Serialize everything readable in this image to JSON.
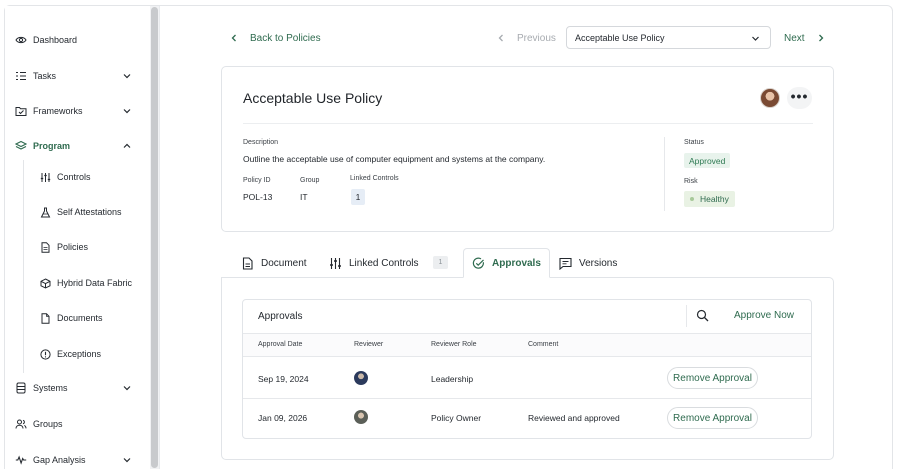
{
  "sidebar": {
    "items": [
      {
        "label": "Dashboard",
        "icon": "eye-icon"
      },
      {
        "label": "Tasks",
        "icon": "list-icon"
      },
      {
        "label": "Frameworks",
        "icon": "folder-check-icon"
      },
      {
        "label": "Program",
        "icon": "layers-icon"
      },
      {
        "label": "Systems",
        "icon": "database-icon"
      },
      {
        "label": "Groups",
        "icon": "users-icon"
      },
      {
        "label": "Gap Analysis",
        "icon": "pulse-icon"
      }
    ],
    "sub_items": [
      {
        "label": "Controls",
        "icon": "sliders-icon"
      },
      {
        "label": "Self Attestations",
        "icon": "flask-icon"
      },
      {
        "label": "Policies",
        "icon": "document-icon"
      },
      {
        "label": "Hybrid Data Fabric",
        "icon": "cube-icon"
      },
      {
        "label": "Documents",
        "icon": "file-icon"
      },
      {
        "label": "Exceptions",
        "icon": "alert-circle-icon"
      }
    ]
  },
  "nav": {
    "back_label": "Back to Policies",
    "previous_label": "Previous",
    "next_label": "Next",
    "selected_policy": "Acceptable Use Policy"
  },
  "policy": {
    "title": "Acceptable Use Policy",
    "description_label": "Description",
    "description": "Outline the acceptable use of computer equipment and systems at the company.",
    "policy_id_label": "Policy ID",
    "policy_id": "POL-13",
    "group_label": "Group",
    "group": "IT",
    "linked_controls_label": "Linked Controls",
    "linked_controls_count": "1",
    "status_label": "Status",
    "status": "Approved",
    "risk_label": "Risk",
    "risk": "Healthy"
  },
  "tabs": [
    {
      "label": "Document"
    },
    {
      "label": "Linked Controls",
      "count": "1"
    },
    {
      "label": "Approvals"
    },
    {
      "label": "Versions"
    }
  ],
  "approvals": {
    "title": "Approvals",
    "approve_now_label": "Approve Now",
    "columns": [
      "Approval Date",
      "Reviewer",
      "Reviewer Role",
      "Comment"
    ],
    "rows": [
      {
        "date": "Sep 19, 2024",
        "role": "Leadership",
        "comment": "",
        "action": "Remove Approval"
      },
      {
        "date": "Jan 09, 2026",
        "role": "Policy Owner",
        "comment": "Reviewed and approved",
        "action": "Remove Approval"
      }
    ]
  },
  "colors": {
    "accent": "#2f6b4f",
    "status_bg": "#e8f3ec",
    "risk_bg": "#e9f2e4"
  }
}
